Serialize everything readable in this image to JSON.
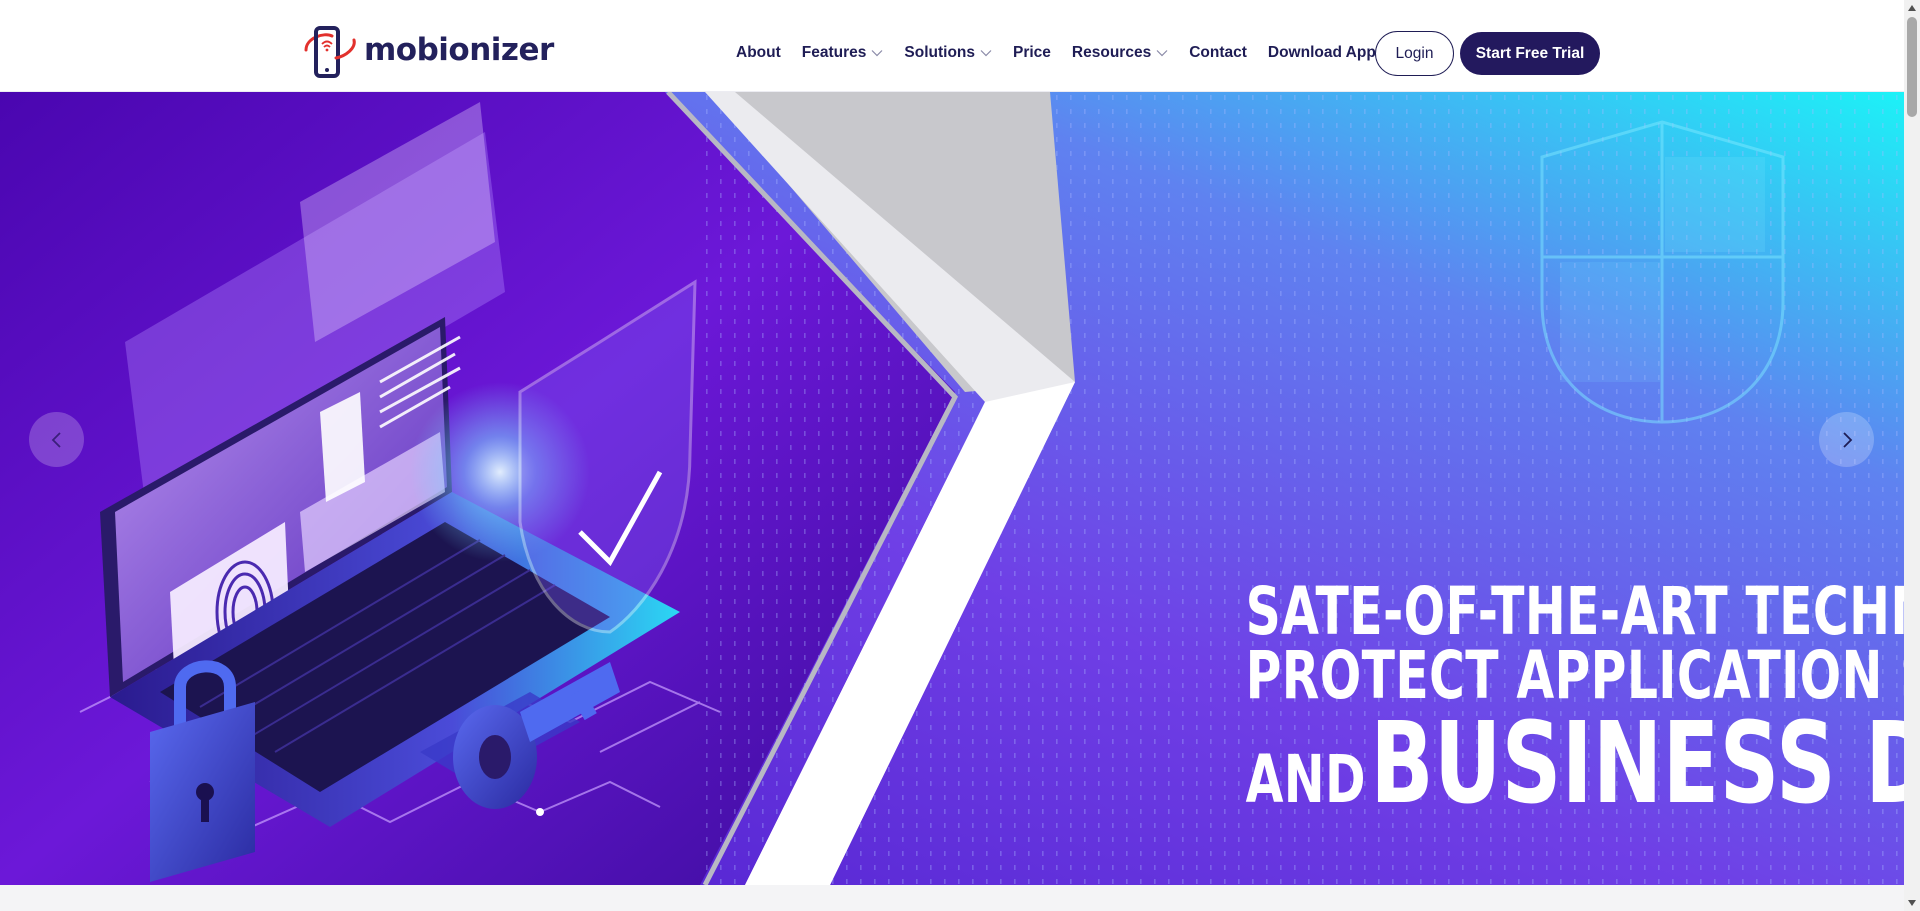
{
  "brand": {
    "name": "mobionizer",
    "logo_icon": "phone-wifi-logo-icon"
  },
  "nav": {
    "items": [
      {
        "label": "About",
        "has_dropdown": false
      },
      {
        "label": "Features",
        "has_dropdown": true
      },
      {
        "label": "Solutions",
        "has_dropdown": true
      },
      {
        "label": "Price",
        "has_dropdown": false
      },
      {
        "label": "Resources",
        "has_dropdown": true
      },
      {
        "label": "Contact",
        "has_dropdown": false
      },
      {
        "label": "Download App",
        "has_dropdown": false
      }
    ],
    "login_label": "Login",
    "trial_label": "Start Free Trial"
  },
  "hero": {
    "line1": "SATE-OF-THE-ART TECHNOLOGY TO",
    "line2": "PROTECT APPLICATION SECURITY",
    "line3_small": "AND",
    "line3_big": "BUSINESS DATA",
    "prev_icon": "chevron-left-icon",
    "next_icon": "chevron-right-icon"
  },
  "colors": {
    "brand_navy": "#23195e",
    "hero_purple": "#5a12c8",
    "hero_cyan": "#1ee6f5",
    "logo_red": "#e2312d"
  }
}
